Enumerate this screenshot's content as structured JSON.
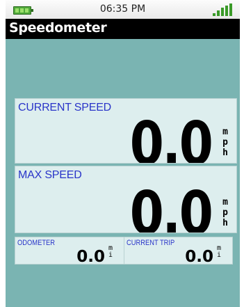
{
  "status_bar": {
    "time": "06:35 PM",
    "battery_icon": "battery-full-icon",
    "signal_icon": "signal-strength-icon",
    "accent_color": "#4fa83a"
  },
  "header": {
    "title": "Speedometer"
  },
  "current_speed": {
    "label": "CURRENT SPEED",
    "value": "0.0",
    "unit_chars": [
      "m",
      "p",
      "h"
    ]
  },
  "max_speed": {
    "label": "MAX SPEED",
    "value": "0.0",
    "unit_chars": [
      "m",
      "p",
      "h"
    ]
  },
  "odometer": {
    "label": "ODOMETER",
    "value": "0.0",
    "unit_chars": [
      "m",
      "i"
    ]
  },
  "current_trip": {
    "label": "CURRENT TRIP",
    "value": "0.0",
    "unit_chars": [
      "m",
      "i"
    ]
  },
  "colors": {
    "background": "#7ab4b2",
    "panel": "#ddeeee",
    "label_blue": "#2a35c9"
  }
}
